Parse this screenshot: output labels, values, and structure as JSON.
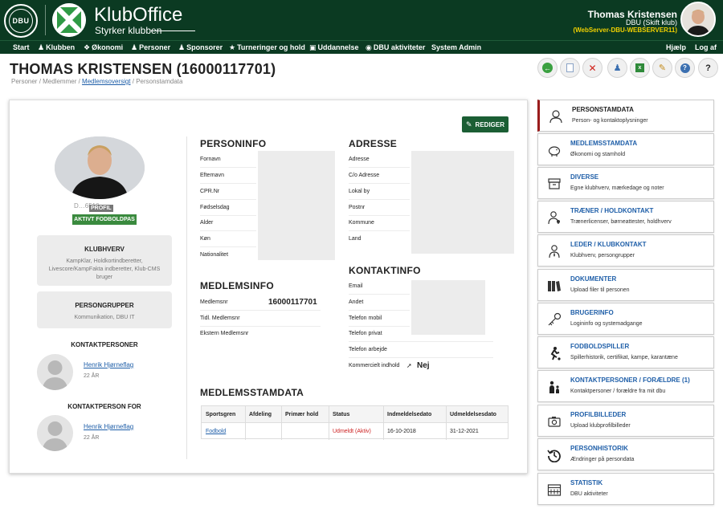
{
  "header": {
    "dbu_logo_text": "DBU",
    "app_title": "KlubOffice",
    "app_tagline": "Styrker klubben",
    "user_name": "Thomas Kristensen",
    "user_club": "DBU (Skift klub)",
    "server": "(WebServer-DBU-WEBSERVER11)"
  },
  "nav": {
    "items": [
      "Start",
      "Klubben",
      "Økonomi",
      "Personer",
      "Sponsorer",
      "Turneringer og hold",
      "Uddannelse",
      "DBU aktiviteter",
      "System Admin"
    ],
    "help": "Hjælp",
    "logout": "Log af"
  },
  "page": {
    "title": "THOMAS KRISTENSEN (16000117701)",
    "breadcrumb": [
      "Personer",
      "Medlemmer",
      "Medlemsoversigt",
      "Personstamdata"
    ],
    "separator": " / ",
    "edit_label": "REDIGER"
  },
  "profile": {
    "member_no_partial": "D…6510",
    "profil_badge": "PROFIL",
    "status_badge": "AKTIVT FODBOLDPAS",
    "klubhverv_title": "KLUBHVERV",
    "klubhverv_text": "KampKlar, Holdkortindberetter, Livescore/KampFakta indberetter, Klub-CMS bruger",
    "persongrupper_title": "PERSONGRUPPER",
    "persongrupper_text": "Kommunikation, DBU IT",
    "kontaktpersoner_title": "KONTAKTPERSONER",
    "kontaktperson_for_title": "KONTAKTPERSON FOR",
    "contacts": [
      {
        "name": "Henrik Hjørneflag",
        "age": "22 ÅR"
      },
      {
        "name": "Henrik Hjørneflag",
        "age": "22 ÅR"
      }
    ]
  },
  "personinfo": {
    "title": "PERSONINFO",
    "labels": [
      "Fornavn",
      "Efternavn",
      "CPR.Nr",
      "Fødselsdag",
      "Alder",
      "Køn",
      "Nationalitet"
    ]
  },
  "adresse": {
    "title": "ADRESSE",
    "labels": [
      "Adresse",
      "C/o Adresse",
      "Lokal by",
      "Postnr",
      "Kommune",
      "Land"
    ]
  },
  "medlemsinfo": {
    "title": "MEDLEMSINFO",
    "labels": [
      "Medlemsnr",
      "Tidl. Medlemsnr",
      "Ekstern Medlemsnr"
    ],
    "medlemsnr": "16000117701"
  },
  "kontaktinfo": {
    "title": "KONTAKTINFO",
    "labels": [
      "Email",
      "Andet",
      "Telefon mobil",
      "Telefon privat",
      "Telefon arbejde",
      "Kommercielt indhold"
    ],
    "kommercielt_value": "Nej"
  },
  "medlemsstamdata": {
    "title": "MEDLEMSSTAMDATA",
    "columns": [
      "Sportsgren",
      "Afdeling",
      "Primær hold",
      "Status",
      "Indmeldelsedato",
      "Udmeldelsesdato"
    ],
    "rows": [
      {
        "sportsgren": "Fodbold",
        "afdeling": "",
        "primaer_hold": "",
        "status": "Udmeldt (Aktiv)",
        "indmeldelse": "16-10-2018",
        "udmeldelse": "31-12-2021"
      }
    ]
  },
  "right_panel": {
    "items": [
      {
        "title": "PERSONSTAMDATA",
        "sub": "Person- og kontaktoplysninger",
        "icon": "person-icon"
      },
      {
        "title": "MEDLEMSSTAMDATA",
        "sub": "Økonomi og stamhold",
        "icon": "piggy-bank-icon"
      },
      {
        "title": "DIVERSE",
        "sub": "Egne klubhverv, mærkedage og noter",
        "icon": "box-icon"
      },
      {
        "title": "TRÆNER / HOLDKONTAKT",
        "sub": "Trænerlicenser, børneattester, holdhverv",
        "icon": "coach-icon"
      },
      {
        "title": "LEDER / KLUBKONTAKT",
        "sub": "Klubhverv, persongrupper",
        "icon": "leader-icon"
      },
      {
        "title": "DOKUMENTER",
        "sub": "Upload filer til personen",
        "icon": "binders-icon"
      },
      {
        "title": "BRUGERINFO",
        "sub": "Logininfo og systemadgange",
        "icon": "key-icon"
      },
      {
        "title": "FODBOLDSPILLER",
        "sub": "Spillerhistorik, certifikat, kampe, karantæne",
        "icon": "player-icon"
      },
      {
        "title": "KONTAKTPERSONER / FORÆLDRE (1)",
        "sub": "Kontaktpersoner / forældre fra mit dbu",
        "icon": "family-icon"
      },
      {
        "title": "PROFILBILLEDER",
        "sub": "Upload klubprofilbilleder",
        "icon": "camera-icon"
      },
      {
        "title": "PERSONHISTORIK",
        "sub": "Ændringer på persondata",
        "icon": "history-icon"
      },
      {
        "title": "STATISTIK",
        "sub": "DBU aktiviteter",
        "icon": "calendar-icon"
      }
    ]
  },
  "colors": {
    "header_bg": "#0b3a22",
    "accent_green": "#1b5e34",
    "badge_green": "#3a8a3e",
    "link_blue": "#1e5ea8",
    "status_red": "#cc1f1f",
    "server_yellow": "#f0d000",
    "active_marker": "#9a1c1c"
  }
}
